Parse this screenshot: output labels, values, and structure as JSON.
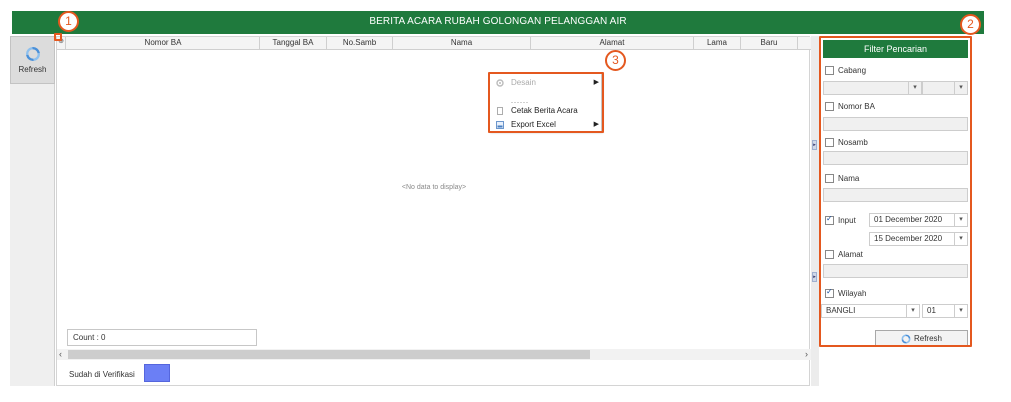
{
  "title": "BERITA ACARA RUBAH GOLONGAN PELANGGAN AIR",
  "toolbar": {
    "refresh_label": "Refresh"
  },
  "grid": {
    "columns": [
      "Nomor BA",
      "Tanggal BA",
      "No.Samb",
      "Nama",
      "Alamat",
      "Lama",
      "Baru"
    ],
    "empty_text": "<No data to display>",
    "count_label": "Count : 0",
    "verification_label": "Sudah di Verifikasi",
    "verification_color": "#6b7ff5"
  },
  "context_menu": {
    "items": [
      {
        "label": "Desain",
        "disabled": true,
        "submenu": true
      },
      {
        "label": "------",
        "separator": true
      },
      {
        "label": "Cetak Berita Acara",
        "disabled": false,
        "submenu": false
      },
      {
        "label": "Export Excel",
        "disabled": false,
        "submenu": true
      }
    ]
  },
  "filter": {
    "title": "Filter Pencarian",
    "cabang_label": "Cabang",
    "cabang_checked": false,
    "nomor_ba_label": "Nomor BA",
    "nomor_ba_checked": false,
    "nosamb_label": "Nosamb",
    "nosamb_checked": false,
    "nama_label": "Nama",
    "nama_checked": false,
    "input_label": "Input",
    "input_checked": true,
    "input_date_from": "01 December 2020",
    "input_date_to": "15 December 2020",
    "alamat_label": "Alamat",
    "alamat_checked": false,
    "wilayah_label": "Wilayah",
    "wilayah_checked": true,
    "wilayah_value": "BANGLI",
    "wilayah_code": "01",
    "refresh_label": "Refresh"
  },
  "callouts": [
    "1",
    "2",
    "3"
  ],
  "colors": {
    "header_green": "#1f7a3d",
    "callout_orange": "#e4581f"
  }
}
